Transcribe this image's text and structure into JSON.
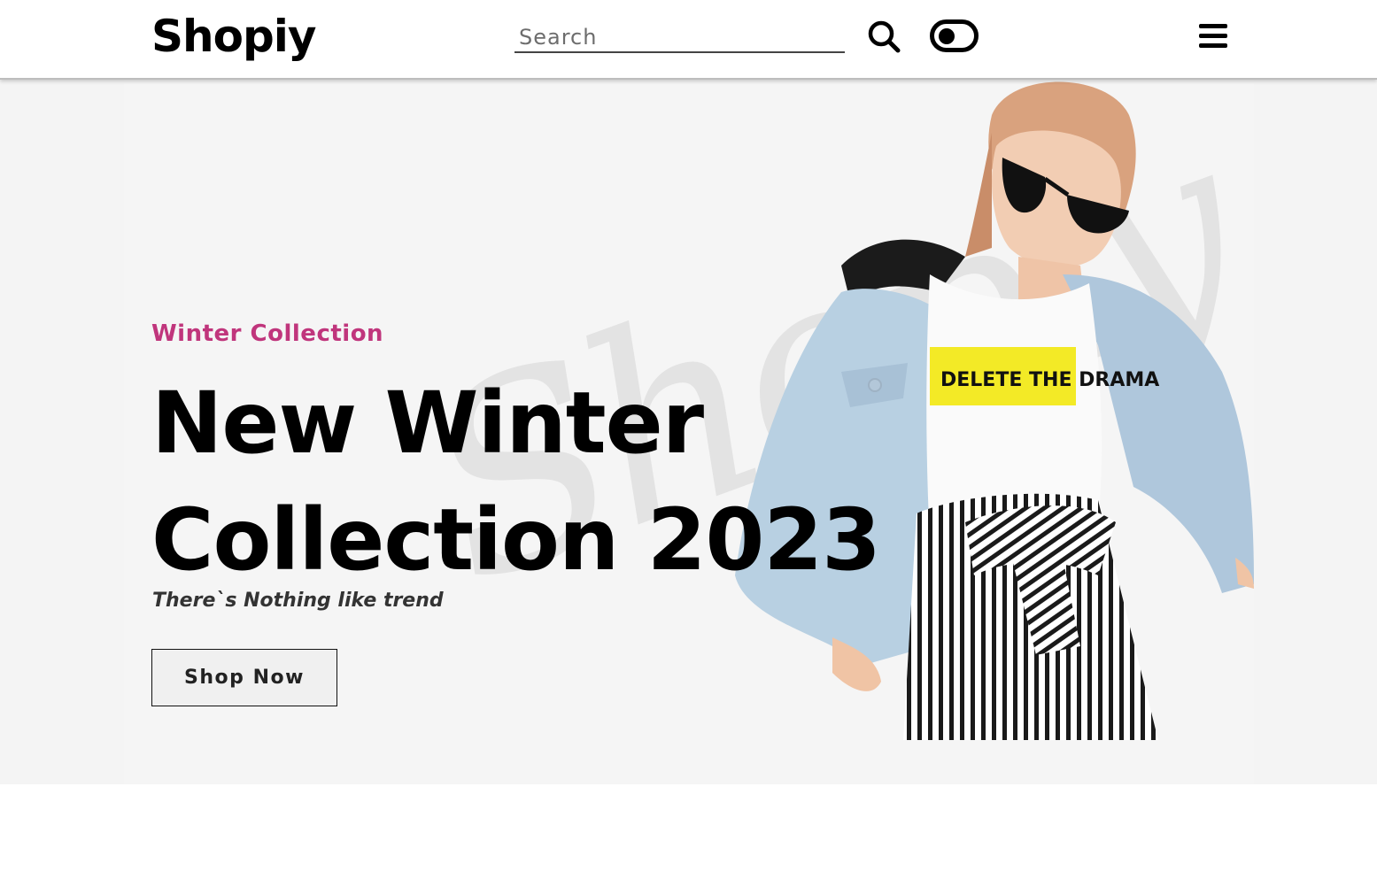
{
  "header": {
    "logo": "Shopiy",
    "search": {
      "placeholder": "Search",
      "value": ""
    },
    "icons": {
      "search": "search-icon",
      "theme_toggle": "toggle-icon",
      "menu": "hamburger-menu-icon"
    }
  },
  "hero": {
    "eyebrow": "Winter Collection",
    "headline_line1": "New Winter",
    "headline_line2": "Collection 2023",
    "tagline": "There`s Nothing like trend",
    "cta_label": "Shop Now",
    "background_mark": "Shopiy",
    "model_shirt_text": "DELETE THE DRAMA",
    "accent_color": "#c0357c"
  }
}
